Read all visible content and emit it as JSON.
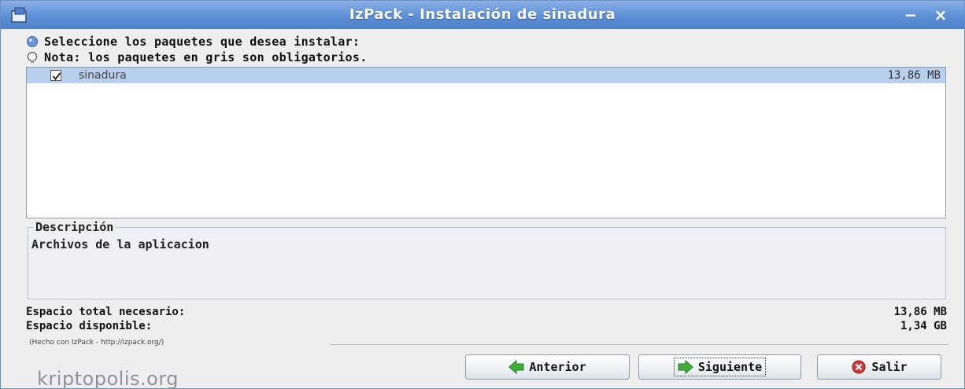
{
  "window": {
    "title": "IzPack - Instalación de sinadura",
    "minimize_symbol": "−",
    "close_symbol": "×"
  },
  "info": {
    "select_text": "Seleccione los paquetes que desea instalar:",
    "note_text": "Nota: los paquetes en gris son obligatorios."
  },
  "packages": [
    {
      "name": "sinadura",
      "size": "13,86 MB",
      "checked": true,
      "selected": true
    }
  ],
  "description": {
    "legend": "Descripción",
    "text": "Archivos de la aplicacion"
  },
  "space": {
    "required_label": "Espacio total necesario:",
    "required_value": "13,86 MB",
    "available_label": "Espacio disponible:",
    "available_value": "1,34 GB"
  },
  "footer": {
    "made_with": "(Hecho con IzPack - http://izpack.org/)",
    "prev_label": "Anterior",
    "next_label": "Siguiente",
    "quit_label": "Salir"
  },
  "watermark": "kriptopolis.org",
  "colors": {
    "titlebar": "#5d8fd6",
    "selection": "#b8cfee",
    "arrow_green": "#3fae3a",
    "quit_red": "#d23a3a"
  },
  "icons": [
    "app-icon",
    "info-bullet-icon",
    "note-bulb-icon",
    "checkbox-checked-icon",
    "arrow-left-icon",
    "arrow-right-icon",
    "quit-icon"
  ]
}
